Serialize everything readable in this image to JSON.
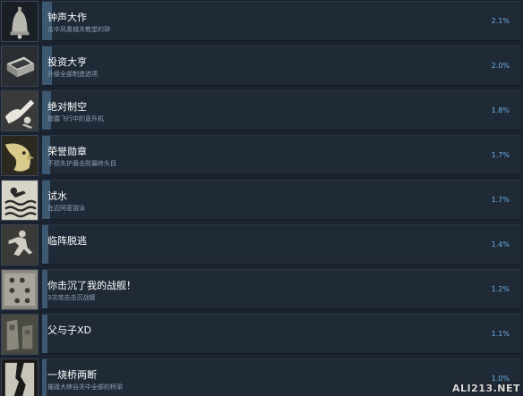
{
  "achievements": [
    {
      "name": "钟声大作",
      "description": "击中凤凰城关教堂的钟",
      "percent_label": "2.1%",
      "percent": 2.1,
      "icon": "bell-icon"
    },
    {
      "name": "投资大亨",
      "description": "升级全部制造选项",
      "percent_label": "2.0%",
      "percent": 2.0,
      "icon": "safe-icon"
    },
    {
      "name": "绝对制空",
      "description": "辞露飞行中的直升机",
      "percent_label": "1.8%",
      "percent": 1.8,
      "icon": "aerial-soldier-icon"
    },
    {
      "name": "荣誉勋章",
      "description": "不损失护盾击败最终头目",
      "percent_label": "1.7%",
      "percent": 1.7,
      "icon": "eagle-icon"
    },
    {
      "name": "试水",
      "description": "在迈阿密游泳",
      "percent_label": "1.7%",
      "percent": 1.7,
      "icon": "swimmer-icon"
    },
    {
      "name": "临阵脱逃",
      "description": "",
      "percent_label": "1.4%",
      "percent": 1.4,
      "icon": "fleeing-soldier-icon"
    },
    {
      "name": "你击沉了我的战舰！",
      "description": "3次攻击击沉战舰",
      "percent_label": "1.2%",
      "percent": 1.2,
      "icon": "battleship-grid-icon"
    },
    {
      "name": "父与子XD",
      "description": "",
      "percent_label": "1.1%",
      "percent": 1.1,
      "icon": "father-son-statue-icon"
    },
    {
      "name": "一烧桥两断",
      "description": "摧毁大峡谷关中全部的桥梁",
      "percent_label": "1.0%",
      "percent": 1.0,
      "icon": "broken-bridge-icon"
    }
  ],
  "watermark": "ALI213.NET"
}
